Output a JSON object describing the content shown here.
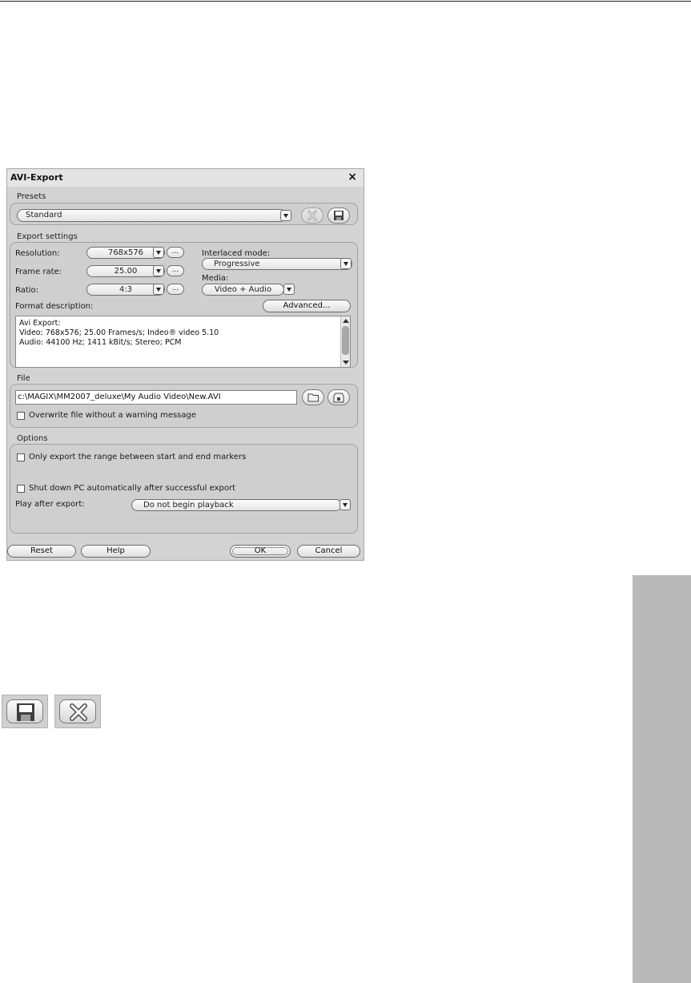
{
  "dialog": {
    "title": "AVI-Export",
    "close_symbol": "×"
  },
  "presets": {
    "section_label": "Presets",
    "selected": "Standard"
  },
  "export_settings": {
    "section_label": "Export settings",
    "resolution_label": "Resolution:",
    "resolution_value": "768x576",
    "frame_rate_label": "Frame rate:",
    "frame_rate_value": "25.00",
    "ratio_label": "Ratio:",
    "ratio_value": "4:3",
    "more_button": "...",
    "interlaced_label": "Interlaced mode:",
    "interlaced_value": "Progressive",
    "media_label": "Media:",
    "media_value": "Video + Audio",
    "format_description_label": "Format description:",
    "advanced_button": "Advanced...",
    "description_lines": [
      "Avi Export:",
      "Video: 768x576; 25.00 Frames/s; Indeo® video 5.10",
      "Audio: 44100 Hz; 1411 kBit/s; Stereo; PCM"
    ]
  },
  "file": {
    "section_label": "File",
    "path": "c:\\MAGIX\\MM2007_deluxe\\My Audio Video\\New.AVI",
    "overwrite_label": "Overwrite file without a warning message"
  },
  "options": {
    "section_label": "Options",
    "range_label": "Only export the range between start and end markers",
    "shutdown_label": "Shut down PC automatically after successful export",
    "play_after_label": "Play after export:",
    "play_after_value": "Do not begin playback"
  },
  "buttons": {
    "reset": "Reset",
    "help": "Help",
    "ok": "OK",
    "cancel": "Cancel"
  },
  "icons": {
    "save": "save-icon",
    "delete": "delete-icon"
  }
}
